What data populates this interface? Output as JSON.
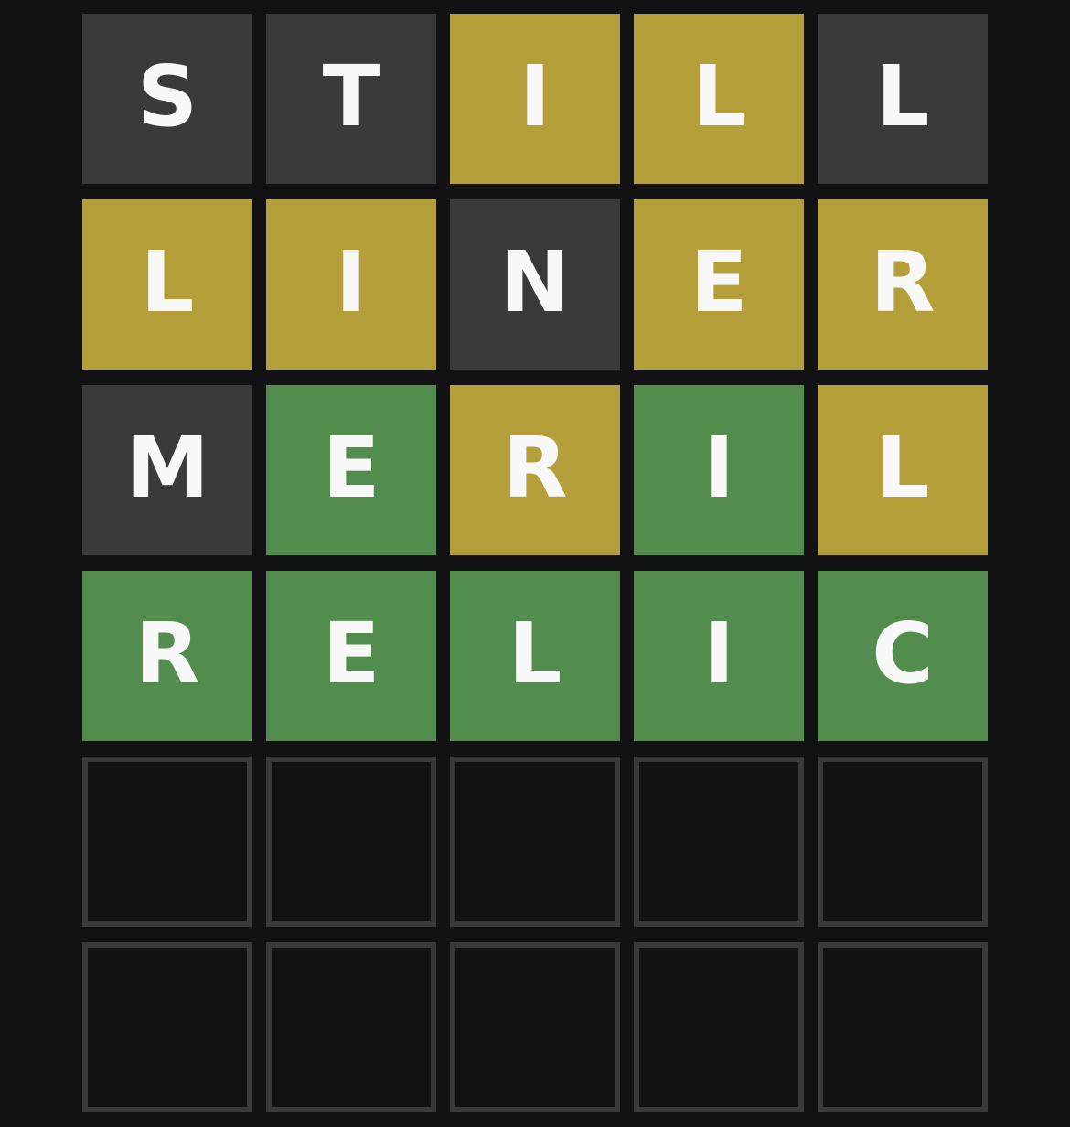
{
  "colors": {
    "background": "#121214",
    "absent": "#3a3a3c",
    "present": "#b59f3b",
    "correct": "#538d4e",
    "empty_border": "#3a3a3c",
    "letter": "#f8f8f8"
  },
  "board": {
    "rows": [
      {
        "guess": "STILL",
        "tiles": [
          {
            "letter": "S",
            "state": "absent"
          },
          {
            "letter": "T",
            "state": "absent"
          },
          {
            "letter": "I",
            "state": "present"
          },
          {
            "letter": "L",
            "state": "present"
          },
          {
            "letter": "L",
            "state": "absent"
          }
        ]
      },
      {
        "guess": "LINER",
        "tiles": [
          {
            "letter": "L",
            "state": "present"
          },
          {
            "letter": "I",
            "state": "present"
          },
          {
            "letter": "N",
            "state": "absent"
          },
          {
            "letter": "E",
            "state": "present"
          },
          {
            "letter": "R",
            "state": "present"
          }
        ]
      },
      {
        "guess": "MERIL",
        "tiles": [
          {
            "letter": "M",
            "state": "absent"
          },
          {
            "letter": "E",
            "state": "correct"
          },
          {
            "letter": "R",
            "state": "present"
          },
          {
            "letter": "I",
            "state": "correct"
          },
          {
            "letter": "L",
            "state": "present"
          }
        ]
      },
      {
        "guess": "RELIC",
        "tiles": [
          {
            "letter": "R",
            "state": "correct"
          },
          {
            "letter": "E",
            "state": "correct"
          },
          {
            "letter": "L",
            "state": "correct"
          },
          {
            "letter": "I",
            "state": "correct"
          },
          {
            "letter": "C",
            "state": "correct"
          }
        ]
      },
      {
        "guess": "",
        "tiles": [
          {
            "letter": "",
            "state": "empty"
          },
          {
            "letter": "",
            "state": "empty"
          },
          {
            "letter": "",
            "state": "empty"
          },
          {
            "letter": "",
            "state": "empty"
          },
          {
            "letter": "",
            "state": "empty"
          }
        ]
      },
      {
        "guess": "",
        "tiles": [
          {
            "letter": "",
            "state": "empty"
          },
          {
            "letter": "",
            "state": "empty"
          },
          {
            "letter": "",
            "state": "empty"
          },
          {
            "letter": "",
            "state": "empty"
          },
          {
            "letter": "",
            "state": "empty"
          }
        ]
      }
    ]
  }
}
